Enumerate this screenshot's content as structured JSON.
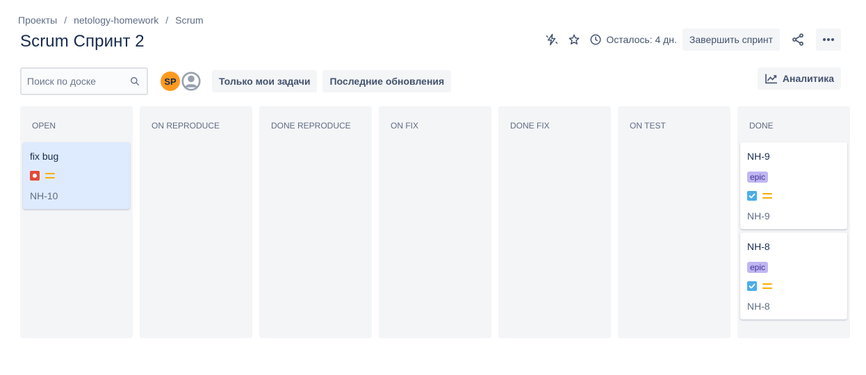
{
  "breadcrumb": {
    "items": [
      "Проекты",
      "netology-homework",
      "Scrum"
    ],
    "separator": "/"
  },
  "page": {
    "title": "Scrum Спринт 2"
  },
  "header": {
    "remaining": "Осталось: 4 дн.",
    "complete_sprint": "Завершить спринт",
    "icons": [
      "automation-icon",
      "star-icon",
      "clock-icon",
      "share-icon",
      "more-icon"
    ]
  },
  "toolbar": {
    "search_placeholder": "Поиск по доске",
    "avatar_initials": "SP",
    "only_my_issues": "Только мои задачи",
    "recently_updated": "Последние обновления",
    "analytics": "Аналитика"
  },
  "columns": [
    {
      "title": "OPEN"
    },
    {
      "title": "ON REPRODUCE"
    },
    {
      "title": "DONE REPRODUCE"
    },
    {
      "title": "ON FIX"
    },
    {
      "title": "DONE FIX"
    },
    {
      "title": "ON TEST"
    },
    {
      "title": "DONE"
    }
  ],
  "cards": {
    "open": [
      {
        "title": "fix bug",
        "type": "bug",
        "priority": "medium",
        "key": "NH-10"
      }
    ],
    "done": [
      {
        "title": "NH-9",
        "epic": "epic",
        "type": "task",
        "priority": "medium",
        "key": "NH-9"
      },
      {
        "title": "NH-8",
        "epic": "epic",
        "type": "task",
        "priority": "medium",
        "key": "NH-8"
      }
    ]
  },
  "colors": {
    "bug": "#e5493a",
    "task": "#4bade8",
    "priority_medium": "#ffab00",
    "epic_bg": "#c0b6f2",
    "avatar_sp": "#ff991f"
  }
}
